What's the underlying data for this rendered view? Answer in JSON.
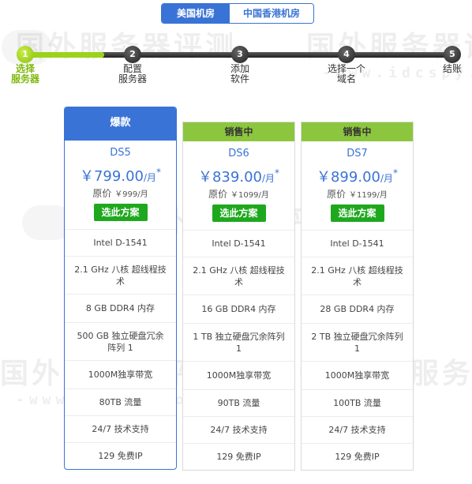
{
  "tabs": [
    {
      "label": "美国机房",
      "active": true
    },
    {
      "label": "中国香港机房",
      "active": false
    }
  ],
  "steps": [
    {
      "num": "1",
      "label": "选择\n服务器",
      "active": true
    },
    {
      "num": "2",
      "label": "配置\n服务器",
      "active": false
    },
    {
      "num": "3",
      "label": "添加\n软件",
      "active": false
    },
    {
      "num": "4",
      "label": "选择一个\n域名",
      "active": false
    },
    {
      "num": "5",
      "label": "结账",
      "active": false
    }
  ],
  "colors": {
    "accent": "#3a73d6",
    "status": "#8cc63f",
    "button": "#1ea81e",
    "step_active": "#8cc10f"
  },
  "watermark": {
    "text": "国外服务器评测",
    "url": "-www.idcspy.org-"
  },
  "plans": [
    {
      "badge": "爆款",
      "name": "DS5",
      "price_prefix": "￥",
      "price": "799.00",
      "unit": "/月",
      "star": "*",
      "orig_label": "原价",
      "orig_price": "￥999/月",
      "button": "选此方案",
      "features": [
        "Intel D-1541",
        "2.1 GHz 八核 超线程技术",
        "8 GB DDR4 内存",
        "500 GB 独立硬盘冗余阵列 1",
        "1000M独享带宽",
        "80TB 流量",
        "24/7 技术支持",
        "129 免费IP"
      ]
    },
    {
      "badge": "销售中",
      "name": "DS6",
      "price_prefix": "￥",
      "price": "839.00",
      "unit": "/月",
      "star": "*",
      "orig_label": "原价",
      "orig_price": "￥1099/月",
      "button": "选此方案",
      "features": [
        "Intel D-1541",
        "2.1 GHz 八核 超线程技术",
        "16 GB DDR4 内存",
        "1 TB 独立硬盘冗余阵列 1",
        "1000M独享带宽",
        "90TB 流量",
        "24/7 技术支持",
        "129 免费IP"
      ]
    },
    {
      "badge": "销售中",
      "name": "DS7",
      "price_prefix": "￥",
      "price": "899.00",
      "unit": "/月",
      "star": "*",
      "orig_label": "原价",
      "orig_price": "￥1199/月",
      "button": "选此方案",
      "features": [
        "Intel D-1541",
        "2.1 GHz 八核 超线程技术",
        "28 GB DDR4 内存",
        "2 TB 独立硬盘冗余阵列 1",
        "1000M独享带宽",
        "100TB 流量",
        "24/7 技术支持",
        "129 免费IP"
      ]
    }
  ]
}
